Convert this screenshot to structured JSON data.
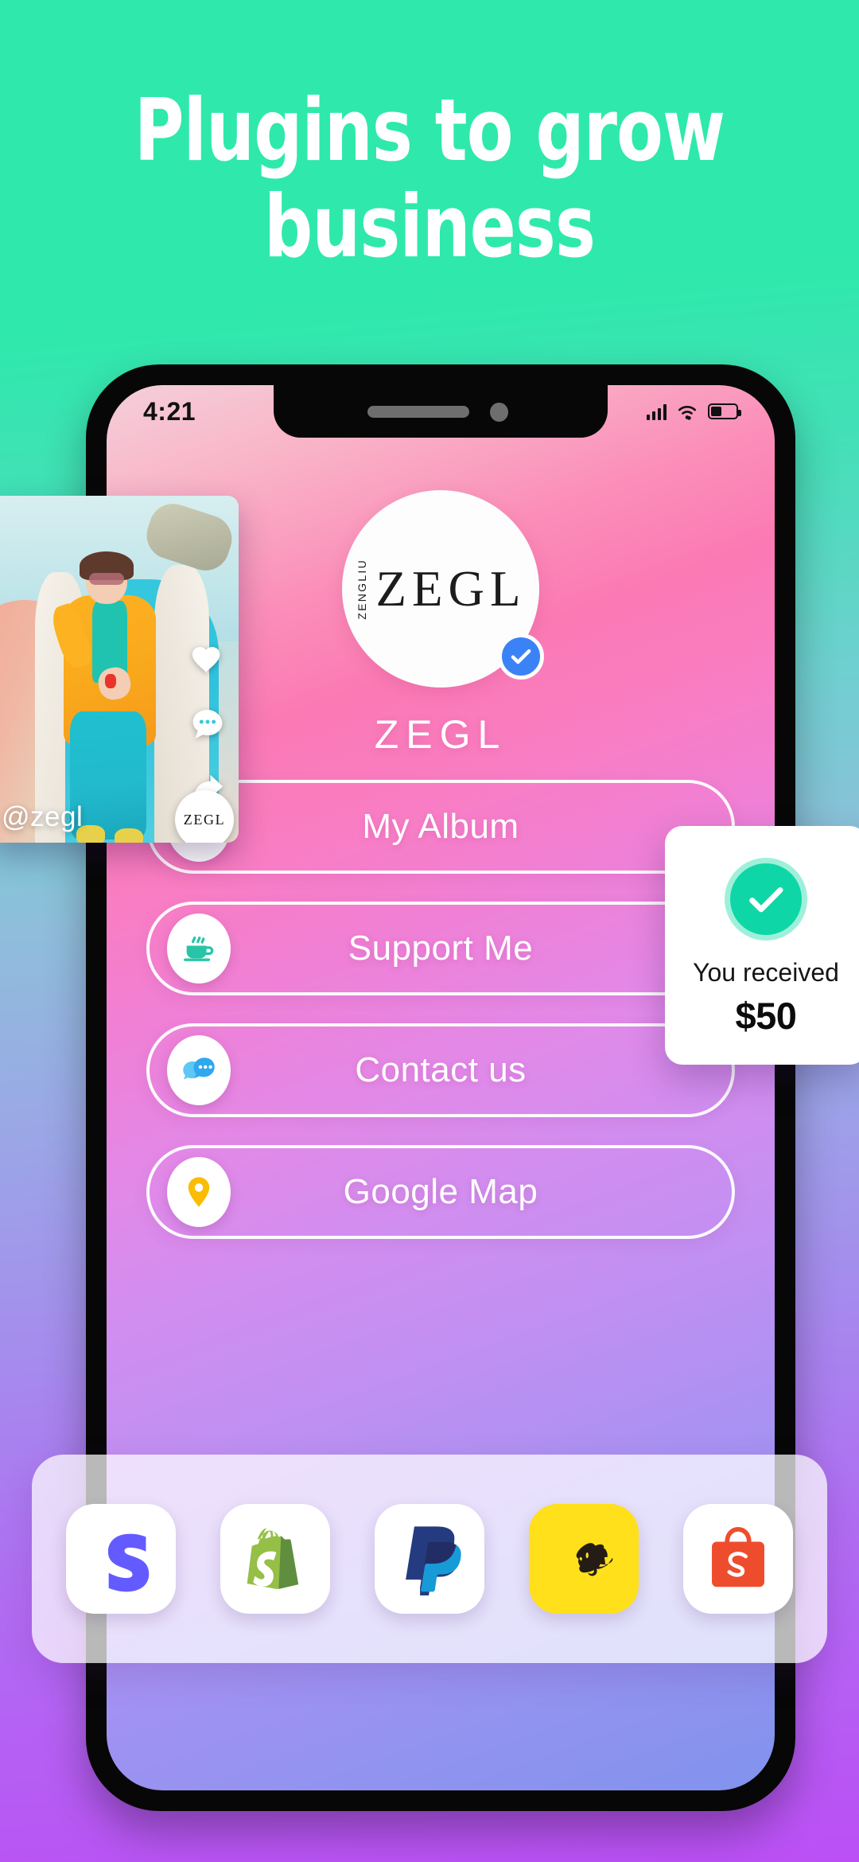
{
  "hero": {
    "headline": "Plugins to grow\nbusiness",
    "background_top_color": "#2ee9ab",
    "background_bottom_color": "#bb4ff5"
  },
  "phone": {
    "status_bar": {
      "time": "4:21",
      "signal_icon": "cellular-signal-icon",
      "wifi_icon": "wifi-icon",
      "battery_icon": "battery-icon"
    },
    "profile": {
      "avatar_sub_text": "ZENGLIU",
      "avatar_main_text": "ZEGL",
      "verified_icon": "verified-check-icon",
      "verified_color": "#3b82f6",
      "display_name": "ZEGL"
    },
    "menu": [
      {
        "label": "My Album",
        "icon": "music-note-icon",
        "icon_color": "#f0392c"
      },
      {
        "label": "Support Me",
        "icon": "coffee-cup-icon",
        "icon_color": "#28c4a8"
      },
      {
        "label": "Contact us",
        "icon": "chat-bubble-icon",
        "icon_color": "#2fa8f0"
      },
      {
        "label": "Google Map",
        "icon": "location-pin-icon",
        "icon_color": "#fbbc04"
      }
    ],
    "screen_gradient_start": "#f9b4c8",
    "screen_gradient_end": "#8193ee"
  },
  "photo_card": {
    "handle": "@zegl",
    "badge_text": "ZEGL",
    "actions": [
      {
        "icon": "heart-icon"
      },
      {
        "icon": "comment-bubble-icon"
      },
      {
        "icon": "share-arrow-icon"
      }
    ]
  },
  "payment_card": {
    "check_icon": "success-check-icon",
    "check_color": "#0fd6a6",
    "message": "You received",
    "amount": "$50"
  },
  "dock": {
    "apps": [
      {
        "name": "stripe-app-icon",
        "label": "Stripe",
        "color": "#635bff",
        "tile": "#ffffff"
      },
      {
        "name": "shopify-app-icon",
        "label": "Shopify",
        "color": "#95bf47",
        "tile": "#ffffff"
      },
      {
        "name": "paypal-app-icon",
        "label": "PayPal",
        "color": "#003087",
        "tile": "#ffffff"
      },
      {
        "name": "mailchimp-app-icon",
        "label": "Mailchimp",
        "color": "#241c15",
        "tile": "#ffe01b"
      },
      {
        "name": "shopee-app-icon",
        "label": "Shopee",
        "color": "#ee4d2d",
        "tile": "#ffffff"
      }
    ]
  }
}
